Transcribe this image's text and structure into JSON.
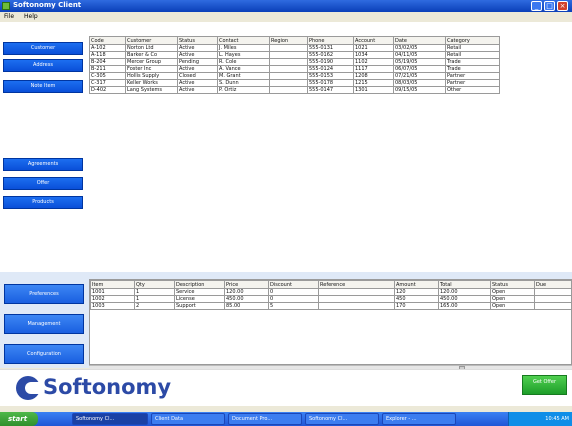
{
  "window": {
    "title": "Softonomy Client",
    "minimize": "_",
    "maximize": "□",
    "close": "×"
  },
  "menu": [
    "File",
    "Help"
  ],
  "nav": {
    "buttons": [
      "Customer",
      "Address",
      "Note Item",
      "Agreements",
      "Offer",
      "Products"
    ],
    "bottom_buttons": [
      "Preferences",
      "Management",
      "Configuration"
    ]
  },
  "top_table": {
    "columns": [
      "Code",
      "Customer",
      "Status",
      "Contact",
      "Region",
      "Phone",
      "Account",
      "Date",
      "Category"
    ],
    "rows": [
      [
        "A-102",
        "Norton Ltd",
        "Active",
        "J. Miles",
        "",
        "555-0131",
        "1021",
        "03/02/05",
        "Retail"
      ],
      [
        "A-118",
        "Barker & Co",
        "Active",
        "L. Hayes",
        "",
        "555-0162",
        "1034",
        "04/11/05",
        "Retail"
      ],
      [
        "B-204",
        "Mercer Group",
        "Pending",
        "R. Cole",
        "",
        "555-0190",
        "1102",
        "05/19/05",
        "Trade"
      ],
      [
        "B-211",
        "Foster Inc",
        "Active",
        "A. Vance",
        "",
        "555-0124",
        "1117",
        "06/07/05",
        "Trade"
      ],
      [
        "C-305",
        "Hollis Supply",
        "Closed",
        "M. Grant",
        "",
        "555-0153",
        "1208",
        "07/21/05",
        "Partner"
      ],
      [
        "C-317",
        "Keller Works",
        "Active",
        "S. Dunn",
        "",
        "555-0178",
        "1215",
        "08/03/05",
        "Partner"
      ],
      [
        "D-402",
        "Lang Systems",
        "Active",
        "P. Ortiz",
        "",
        "555-0147",
        "1301",
        "09/15/05",
        "Other"
      ]
    ]
  },
  "bottom_table": {
    "columns": [
      "Item",
      "Qty",
      "Description",
      "Price",
      "Discount",
      "Reference",
      "Amount",
      "Total",
      "Status",
      "Due"
    ],
    "rows": [
      [
        "1001",
        "1",
        "Service",
        "120.00",
        "0",
        "",
        "120",
        "120.00",
        "Open",
        ""
      ],
      [
        "1002",
        "1",
        "License",
        "450.00",
        "0",
        "",
        "450",
        "450.00",
        "Open",
        ""
      ],
      [
        "1003",
        "2",
        "Support",
        "85.00",
        "5",
        "",
        "170",
        "165.00",
        "Open",
        ""
      ]
    ]
  },
  "brand": {
    "logo_text": "Softonomy",
    "action_button": "Get Offer"
  },
  "taskbar": {
    "start": "start",
    "items": [
      "Softonomy Cl...",
      "Client Data",
      "Document Pro...",
      "Softonomy Cl...",
      "Explorer - ..."
    ],
    "clock": "10:45 AM"
  },
  "colors": {
    "nav_blue": "#0a4fd8",
    "brand_blue": "#2c4aa6",
    "action_green": "#1e9e2a"
  }
}
